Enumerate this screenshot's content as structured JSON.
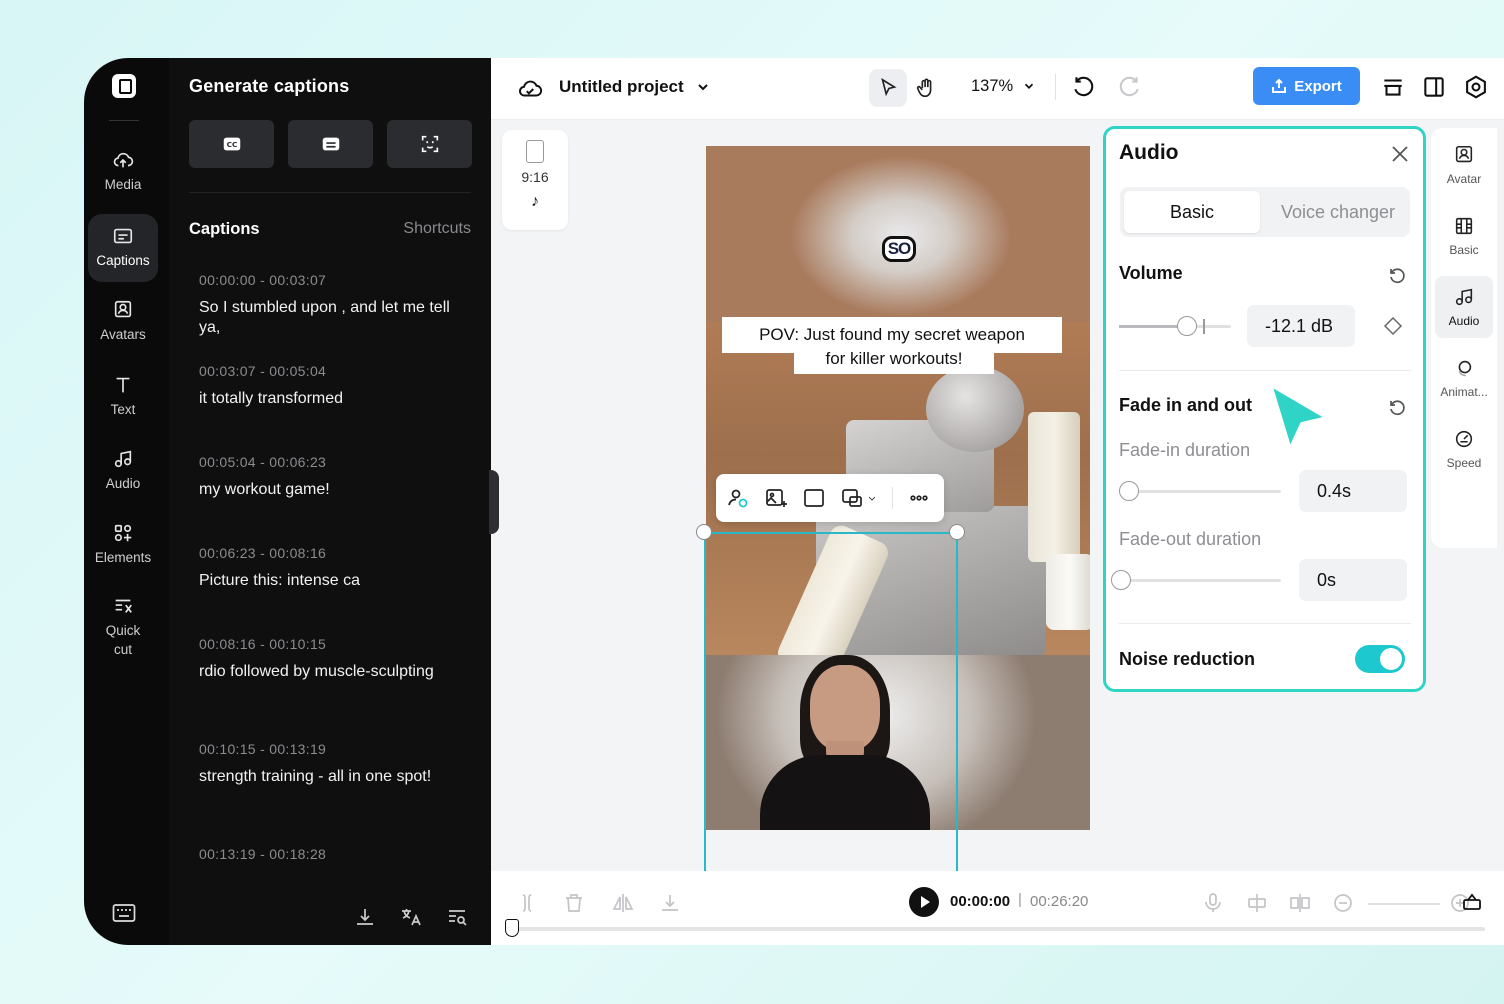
{
  "rail": {
    "items": [
      {
        "label": "Media",
        "icon": "cloud-upload-icon"
      },
      {
        "label": "Captions",
        "icon": "captions-icon",
        "active": true
      },
      {
        "label": "Avatars",
        "icon": "avatar-icon"
      },
      {
        "label": "Text",
        "icon": "text-icon"
      },
      {
        "label": "Audio",
        "icon": "music-note-icon"
      },
      {
        "label": "Elements",
        "icon": "elements-icon"
      },
      {
        "label": "Quick\ncut",
        "icon": "quick-cut-icon"
      }
    ]
  },
  "captions_panel": {
    "title": "Generate captions",
    "section_title": "Captions",
    "shortcuts_label": "Shortcuts",
    "entries": [
      {
        "time": "00:00:00 - 00:03:07",
        "text": "So I stumbled upon , and let me tell ya,"
      },
      {
        "time": "00:03:07 - 00:05:04",
        "text": "it totally transformed"
      },
      {
        "time": "00:05:04 - 00:06:23",
        "text": "my workout game!"
      },
      {
        "time": "00:06:23 - 00:08:16",
        "text": "Picture this: intense ca"
      },
      {
        "time": "00:08:16 - 00:10:15",
        "text": "rdio followed by muscle-sculpting"
      },
      {
        "time": "00:10:15 - 00:13:19",
        "text": "strength training - all in one spot!"
      },
      {
        "time": "00:13:19 - 00:18:28",
        "text": ""
      }
    ]
  },
  "topbar": {
    "project_name": "Untitled project",
    "zoom": "137%",
    "export_label": "Export"
  },
  "canvas": {
    "ratio": "9:16",
    "caption_line1": "POV: Just found my secret weapon",
    "caption_line2": "for killer workouts!",
    "badge": "SO"
  },
  "audio_panel": {
    "title": "Audio",
    "tabs": [
      "Basic",
      "Voice changer"
    ],
    "volume_label": "Volume",
    "volume_value": "-12.1 dB",
    "fade_label": "Fade in and out",
    "fade_in_label": "Fade-in duration",
    "fade_in_value": "0.4s",
    "fade_out_label": "Fade-out duration",
    "fade_out_value": "0s",
    "noise_label": "Noise reduction",
    "noise_on": true
  },
  "right_rail": {
    "items": [
      {
        "label": "Avatar",
        "icon": "avatar-icon"
      },
      {
        "label": "Basic",
        "icon": "film-icon"
      },
      {
        "label": "Audio",
        "icon": "music-note-icon",
        "active": true
      },
      {
        "label": "Animat...",
        "icon": "animation-icon"
      },
      {
        "label": "Speed",
        "icon": "speed-icon"
      }
    ]
  },
  "timeline": {
    "current_time": "00:00:00",
    "separator": "|",
    "total_time": "00:26:20"
  },
  "colors": {
    "accent": "#2fd4c6",
    "export": "#3a8df5",
    "toggle": "#1ec8cf"
  }
}
